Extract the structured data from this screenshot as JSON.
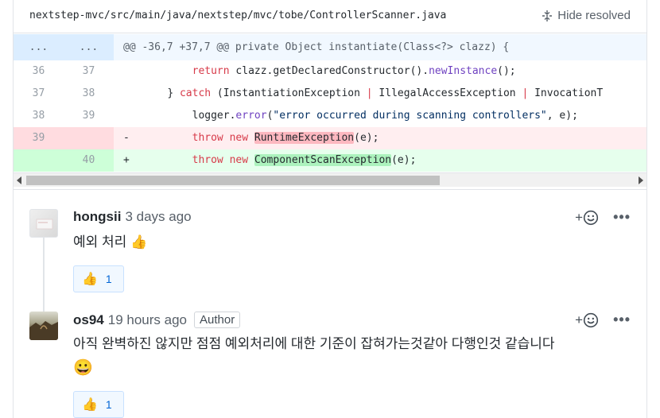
{
  "file": {
    "path": "nextstep-mvc/src/main/java/nextstep/mvc/tobe/ControllerScanner.java",
    "hide_resolved_label": "Hide resolved"
  },
  "diff": {
    "hunk": {
      "left": "...",
      "right": "...",
      "text": "@@ -36,7 +37,7 @@ private Object instantiate(Class<?> clazz) {"
    },
    "lines": [
      {
        "old": "36",
        "new": "37"
      },
      {
        "old": "37",
        "new": "38"
      },
      {
        "old": "38",
        "new": "39"
      },
      {
        "old": "39",
        "new": "",
        "marker": "-"
      },
      {
        "old": "",
        "new": "40",
        "marker": "+"
      }
    ],
    "tokens": {
      "return": "return",
      "clazz_call": "clazz.getDeclaredConstructor().",
      "new_instance": "newInstance",
      "parens_semi": "();",
      "close_brace": "} ",
      "catch": "catch",
      "catch_args1": " (InstantiationException ",
      "pipe": "|",
      "catch_args2": " IllegalAccessException ",
      "catch_args3": " InvocationT",
      "logger": "logger.",
      "error_fn": "error",
      "open_paren": "(",
      "error_msg": "\"error occurred during scanning controllers\"",
      "error_tail": ", e);",
      "throw": "throw",
      "new": "new",
      "old_exception": "RuntimeException",
      "new_exception": "ComponentScanException",
      "exc_tail": "(e);"
    }
  },
  "comments": [
    {
      "author": "hongsii",
      "time": "3 days ago",
      "body": "예외 처리",
      "body_emoji": "👍",
      "reaction_emoji": "👍",
      "reaction_count": "1"
    },
    {
      "author": "os94",
      "time": "19 hours ago",
      "badge": "Author",
      "body": "아직 완벽하진 않지만 점점 예외처리에 대한 기준이 잡혀가는것같아 다행인것 같습니다",
      "body_emoji": "😀",
      "reaction_emoji": "👍",
      "reaction_count": "1"
    }
  ],
  "icons": {
    "hide_resolved": "fold-icon",
    "add_reaction": "smiley-plus-icon",
    "more": "kebab-horizontal-icon"
  },
  "colors": {
    "deleted_bg": "#ffeef0",
    "added_bg": "#e6ffed",
    "hunk_bg": "#f1f8ff",
    "keyword": "#d73a49",
    "link": "#0366d6"
  }
}
